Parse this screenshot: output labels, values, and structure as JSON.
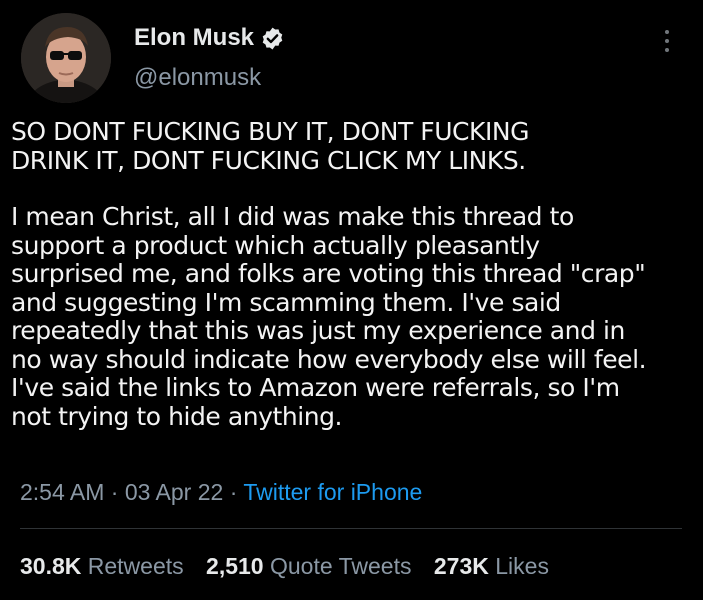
{
  "author": {
    "name": "Elon Musk",
    "handle": "@elonmusk",
    "verified_icon": "verified-badge-icon",
    "accent": "#1d9bf0"
  },
  "tweet": {
    "paragraph1": "SO DONT FUCKING BUY IT, DONT FUCKING\nDRINK IT, DONT FUCKING CLICK MY LINKS.",
    "paragraph2": "I mean Christ, all I did was make this thread to\nsupport a product which actually pleasantly\nsurprised me, and folks are voting this thread \"crap\"\nand suggesting I'm scamming them. I've said\nrepeatedly that this was just my experience and in\nno way should indicate how everybody else will feel.\nI've said the links to Amazon were referrals, so I'm\nnot trying to hide anything."
  },
  "meta": {
    "time": "2:54 AM",
    "sep1": " · ",
    "date": "03 Apr 22",
    "sep2": " · ",
    "source": "Twitter for iPhone"
  },
  "stats": {
    "retweets_count": "30.8K",
    "retweets_label": "Retweets",
    "quotes_count": "2,510",
    "quotes_label": "Quote Tweets",
    "likes_count": "273K",
    "likes_label": "Likes"
  }
}
